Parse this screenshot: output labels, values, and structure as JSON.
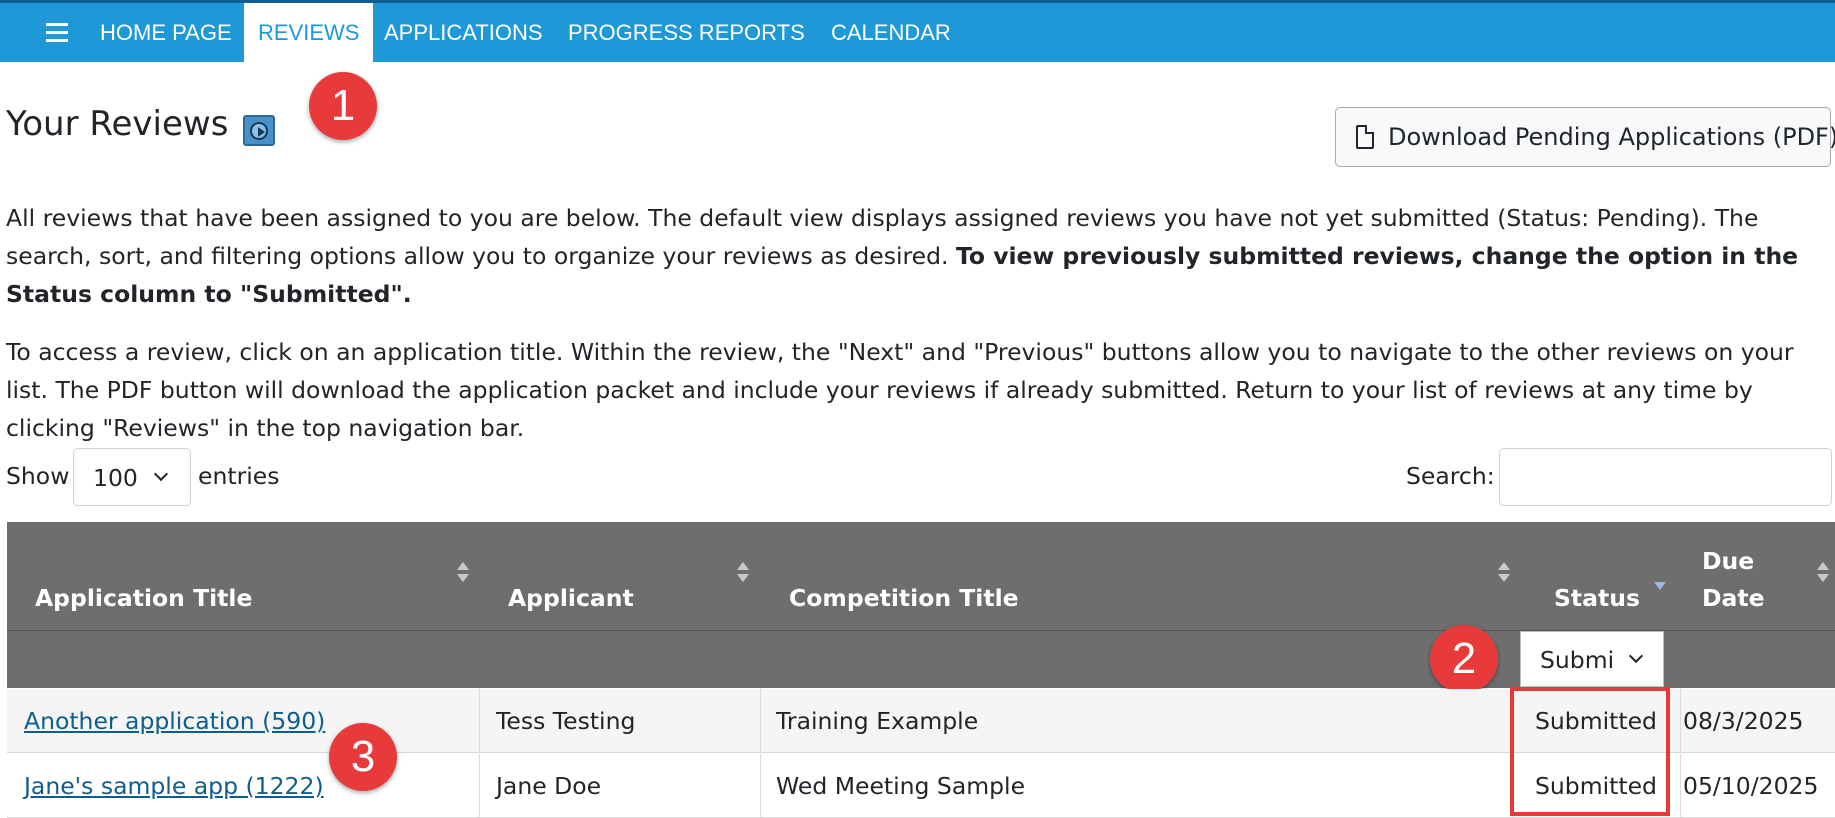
{
  "navbar": {
    "items": [
      {
        "label": "HOME PAGE",
        "active": false
      },
      {
        "label": "REVIEWS",
        "active": true
      },
      {
        "label": "APPLICATIONS",
        "active": false
      },
      {
        "label": "PROGRESS REPORTS",
        "active": false
      },
      {
        "label": "CALENDAR",
        "active": false
      }
    ]
  },
  "header": {
    "title": "Your Reviews",
    "download_button": "Download Pending Applications (PDF)"
  },
  "intro": {
    "p1_text": "All reviews that have been assigned to you are below. The default view displays assigned reviews you have not yet submitted (Status: Pending). The search, sort, and filtering options allow you to organize your reviews as desired. ",
    "p1_bold": "To view previously submitted reviews, change the option in the Status column to \"Submitted\".",
    "p2": "To access a review, click on an application title. Within the review, the \"Next\" and \"Previous\" buttons allow you to navigate to the other reviews on your list. The PDF button will download the application packet and include your reviews if already submitted. Return to your list of reviews at any time by clicking \"Reviews\" in the top navigation bar."
  },
  "controls": {
    "show_label": "Show",
    "entries_value": "100",
    "entries_label": "entries",
    "search_label": "Search:",
    "search_value": ""
  },
  "table": {
    "columns": [
      "Application Title",
      "Applicant",
      "Competition Title",
      "Status",
      "Due",
      "Date"
    ],
    "status_filter": "Submi",
    "rows": [
      {
        "application_title": "Another application (590)",
        "applicant": "Tess Testing",
        "competition_title": "Training Example",
        "status": "Submitted",
        "due_date": "08/3/2025"
      },
      {
        "application_title": "Jane's sample app (1222)",
        "applicant": "Jane Doe",
        "competition_title": "Wed Meeting Sample",
        "status": "Submitted",
        "due_date": "05/10/2025"
      }
    ]
  },
  "annotations": {
    "marker_1": "1",
    "marker_2": "2",
    "marker_3": "3",
    "color": "#e83a3a"
  },
  "colors": {
    "navbar": "#1e98d7",
    "table_header": "#6e6e6e",
    "link": "#0e5d8c"
  }
}
